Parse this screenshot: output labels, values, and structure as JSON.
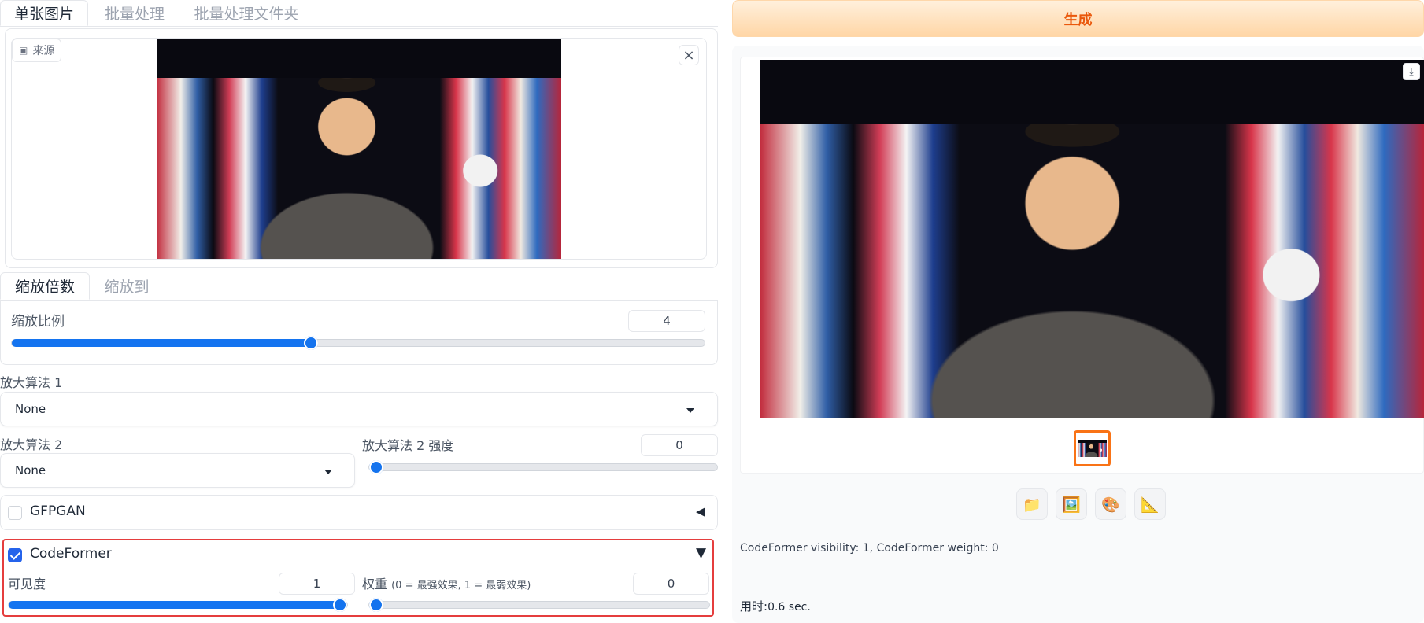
{
  "left": {
    "source_tabs": [
      {
        "label": "单张图片",
        "active": true
      },
      {
        "label": "批量处理",
        "active": false
      },
      {
        "label": "批量处理文件夹",
        "active": false
      }
    ],
    "source_button_label": "来源",
    "close_glyph": "×",
    "scale_tabs": [
      {
        "label": "缩放倍数",
        "active": true
      },
      {
        "label": "缩放到",
        "active": false
      }
    ],
    "scale_ratio": {
      "label": "缩放比例",
      "value": "4",
      "fraction": 0.43
    },
    "upscaler1": {
      "label": "放大算法 1",
      "selected": "None"
    },
    "upscaler2": {
      "label": "放大算法 2",
      "selected": "None"
    },
    "upscaler2_strength": {
      "label": "放大算法 2 强度",
      "value": "0",
      "fraction": 0.0
    },
    "gfpgan": {
      "label": "GFPGAN",
      "checked": false,
      "arrow": "◀"
    },
    "codeformer": {
      "label": "CodeFormer",
      "checked": true,
      "arrow": "▼",
      "visibility": {
        "label": "可见度",
        "value": "1",
        "fraction": 1.0
      },
      "weight": {
        "label_main": "权重",
        "label_note": "(0 = 最强效果, 1 = 最弱效果)",
        "value": "0",
        "fraction": 0.0
      },
      "highlight_color": "#e53e3e"
    }
  },
  "right": {
    "generate_label": "生成",
    "generate_color": "#ea580c",
    "download_icon": "download-icon",
    "tools": [
      {
        "name": "folder-icon",
        "glyph": "📁"
      },
      {
        "name": "image-icon",
        "glyph": "🖼️"
      },
      {
        "name": "palette-icon",
        "glyph": "🎨"
      },
      {
        "name": "ruler-triangle-icon",
        "glyph": "📐"
      }
    ],
    "info_text": "CodeFormer visibility: 1, CodeFormer weight: 0",
    "time_label": "用时:",
    "time_value": "0.6 sec."
  },
  "colors": {
    "accent": "#1474f0",
    "orange": "#ea580c",
    "border": "#e5e7eb"
  }
}
